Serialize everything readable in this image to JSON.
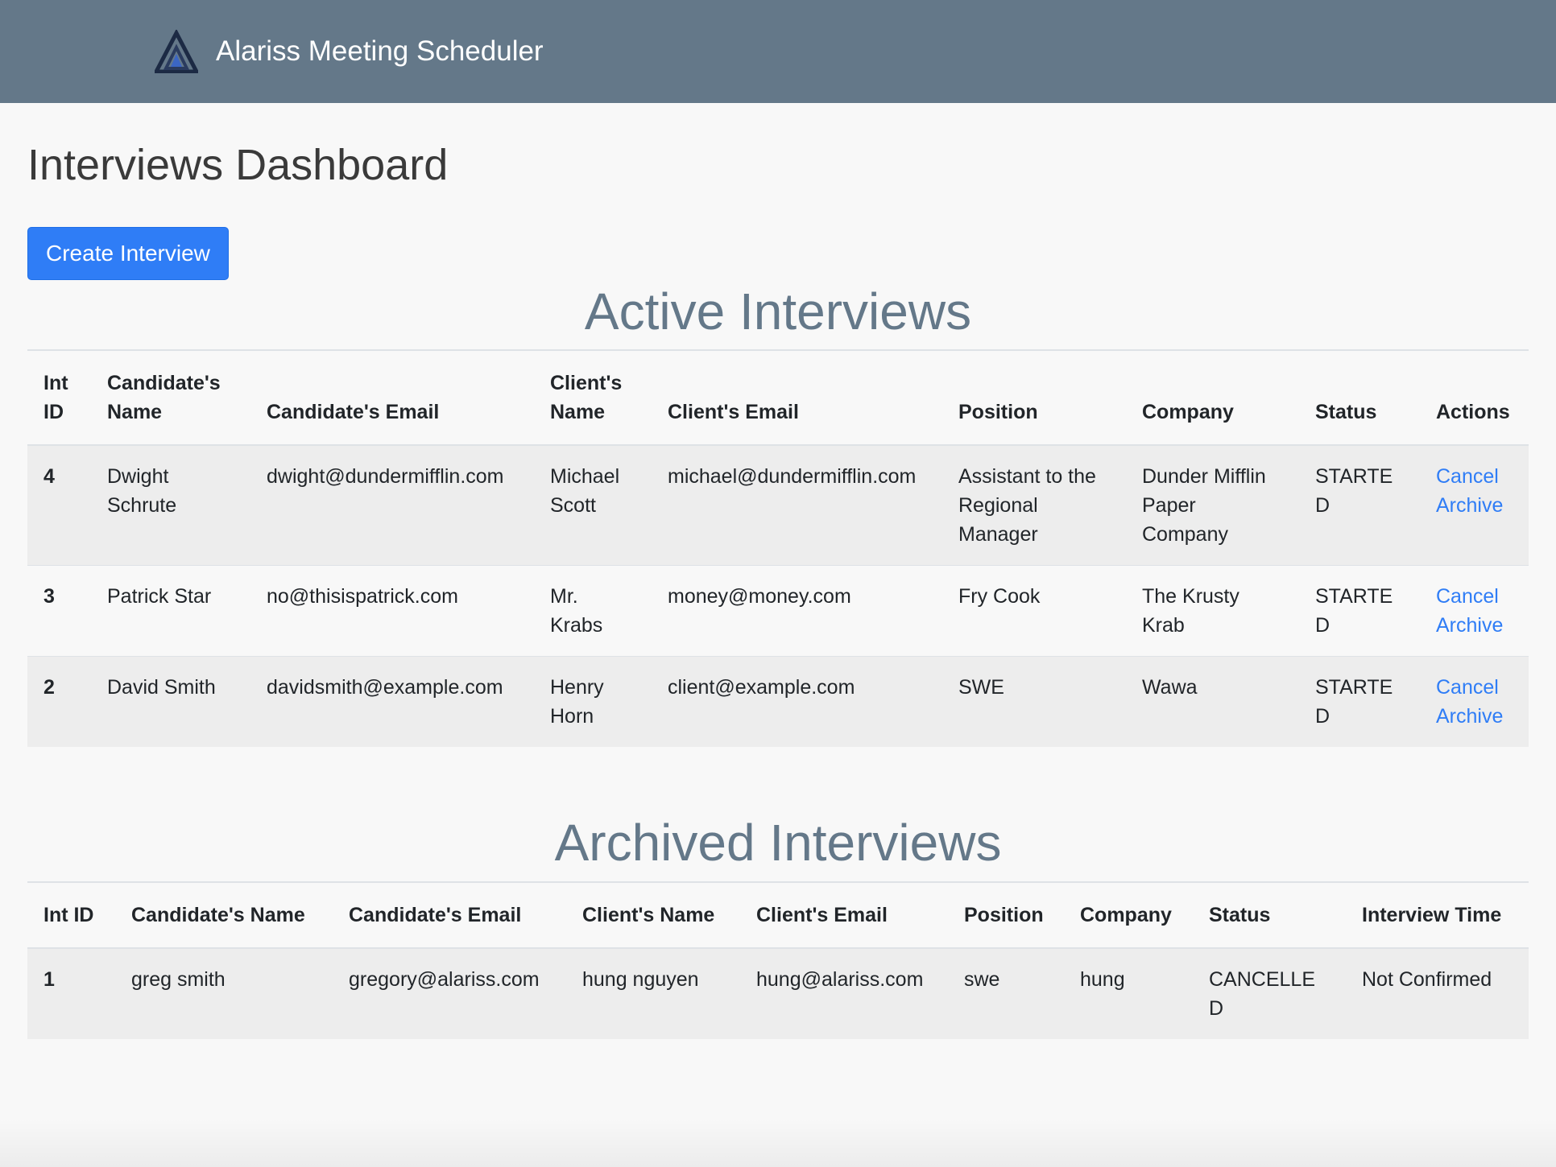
{
  "app": {
    "brand": "Alariss Meeting Scheduler",
    "logo_icon": "alariss-triangle-logo-icon"
  },
  "page": {
    "title": "Interviews Dashboard",
    "create_button": "Create Interview"
  },
  "active": {
    "title": "Active Interviews",
    "headers": [
      "Int ID",
      "Candidate's Name",
      "Candidate's Email",
      "Client's Name",
      "Client's Email",
      "Position",
      "Company",
      "Status",
      "Actions"
    ],
    "rows": [
      {
        "id": "4",
        "candidate": "Dwight Schrute",
        "candidate_email": "dwight@dundermifflin.com",
        "client": "Michael Scott",
        "client_email": "michael@dundermifflin.com",
        "position": "Assistant to the Regional Manager",
        "company": "Dunder Mifflin Paper Company",
        "status": "STARTED",
        "action_cancel": "Cancel",
        "action_archive": "Archive"
      },
      {
        "id": "3",
        "candidate": "Patrick Star",
        "candidate_email": "no@thisispatrick.com",
        "client": "Mr. Krabs",
        "client_email": "money@money.com",
        "position": "Fry Cook",
        "company": "The Krusty Krab",
        "status": "STARTED",
        "action_cancel": "Cancel",
        "action_archive": "Archive"
      },
      {
        "id": "2",
        "candidate": "David Smith",
        "candidate_email": "davidsmith@example.com",
        "client": "Henry Horn",
        "client_email": "client@example.com",
        "position": "SWE",
        "company": "Wawa",
        "status": "STARTED",
        "action_cancel": "Cancel",
        "action_archive": "Archive"
      }
    ]
  },
  "archived": {
    "title": "Archived Interviews",
    "headers": [
      "Int ID",
      "Candidate's Name",
      "Candidate's Email",
      "Client's Name",
      "Client's Email",
      "Position",
      "Company",
      "Status",
      "Interview Time"
    ],
    "rows": [
      {
        "id": "1",
        "candidate": "greg smith",
        "candidate_email": "gregory@alariss.com",
        "client": "hung nguyen",
        "client_email": "hung@alariss.com",
        "position": "swe",
        "company": "hung",
        "status": "CANCELLED",
        "interview_time": "Not Confirmed"
      }
    ]
  },
  "colors": {
    "navbar": "#647889",
    "accent": "#2f7df6",
    "section_title": "#647889"
  }
}
